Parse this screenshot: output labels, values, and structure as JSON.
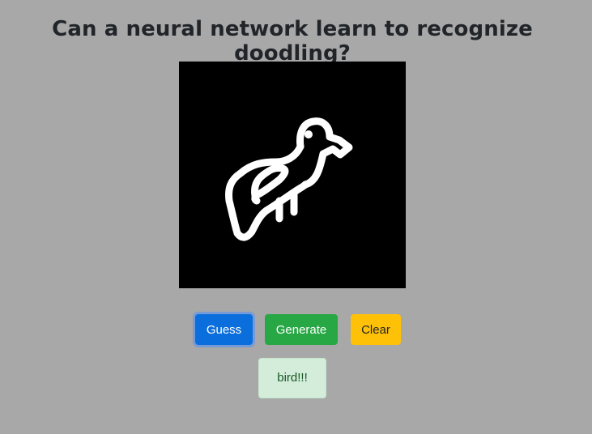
{
  "heading": "Can a neural network learn to recognize doodling?",
  "canvas": {
    "background": "#000000",
    "stroke_color": "#ffffff",
    "doodle_subject": "bird"
  },
  "buttons": {
    "guess_label": "Guess",
    "generate_label": "Generate",
    "clear_label": "Clear"
  },
  "result": {
    "text": "bird!!!"
  },
  "colors": {
    "page_background": "#a8a8a8",
    "guess": "#0a6fdc",
    "generate": "#28a745",
    "clear": "#ffc107",
    "result_background": "#d4edda",
    "result_text": "#155724"
  }
}
